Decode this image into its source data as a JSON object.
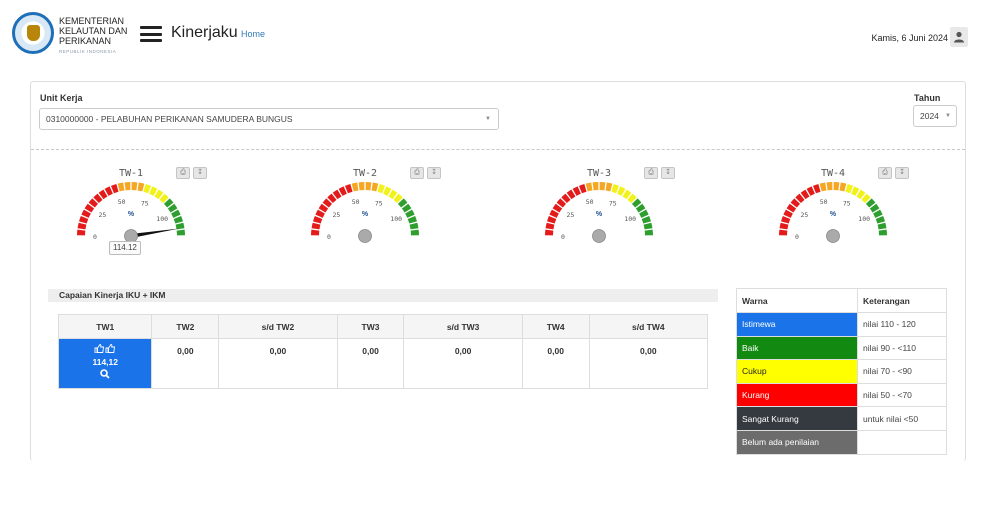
{
  "header": {
    "org_line1": "KEMENTERIAN",
    "org_line2": "KELAUTAN DAN",
    "org_line3": "PERIKANAN",
    "org_sub": "REPUBLIK INDONESIA",
    "app_title": "Kinerjaku",
    "home_link": "Home",
    "date": "Kamis, 6 Juni 2024"
  },
  "filters": {
    "unit_label": "Unit Kerja",
    "unit_value": "0310000000 - PELABUHAN PERIKANAN SAMUDERA BUNGUS",
    "year_label": "Tahun",
    "year_value": "2024"
  },
  "gauges": [
    {
      "label": "TW-1",
      "value": 114.12,
      "value_text": "114.12"
    },
    {
      "label": "TW-2",
      "value": null,
      "value_text": ""
    },
    {
      "label": "TW-3",
      "value": null,
      "value_text": ""
    },
    {
      "label": "TW-4",
      "value": null,
      "value_text": ""
    }
  ],
  "gauge_ticks": {
    "t0": "0",
    "t25": "25",
    "t50": "50",
    "t75": "75",
    "t100": "100",
    "unit": "%"
  },
  "gauge_colors": {
    "red": "#e31b1b",
    "orange": "#f5a623",
    "yellow": "#f2f21a",
    "green": "#2e9e2e"
  },
  "capaian": {
    "title": "Capaian Kinerja IKU + IKM",
    "headers": [
      "TW1",
      "TW2",
      "s/d TW2",
      "TW3",
      "s/d TW3",
      "TW4",
      "s/d TW4"
    ],
    "tw1_value": "114,12",
    "tw1_icons": [
      "thumbs-up-icon",
      "thumbs-up-icon"
    ],
    "values": [
      "0,00",
      "0,00",
      "0,00",
      "0,00",
      "0,00",
      "0,00"
    ]
  },
  "legend": {
    "header_color": "Warna",
    "header_desc": "Keterangan",
    "rows": [
      {
        "label": "Istimewa",
        "desc": "nilai 110 - 120",
        "color": "#1a73e8"
      },
      {
        "label": "Baik",
        "desc": "nilai 90 - <110",
        "color": "#128a12"
      },
      {
        "label": "Cukup",
        "desc": "nilai 70 - <90",
        "color": "#ffff00"
      },
      {
        "label": "Kurang",
        "desc": "nilai 50 - <70",
        "color": "#ff0000"
      },
      {
        "label": "Sangat Kurang",
        "desc": "untuk nilai <50",
        "color": "#343a40"
      },
      {
        "label": "Belum ada penilaian",
        "desc": "",
        "color": "#6c6c6c"
      }
    ]
  }
}
